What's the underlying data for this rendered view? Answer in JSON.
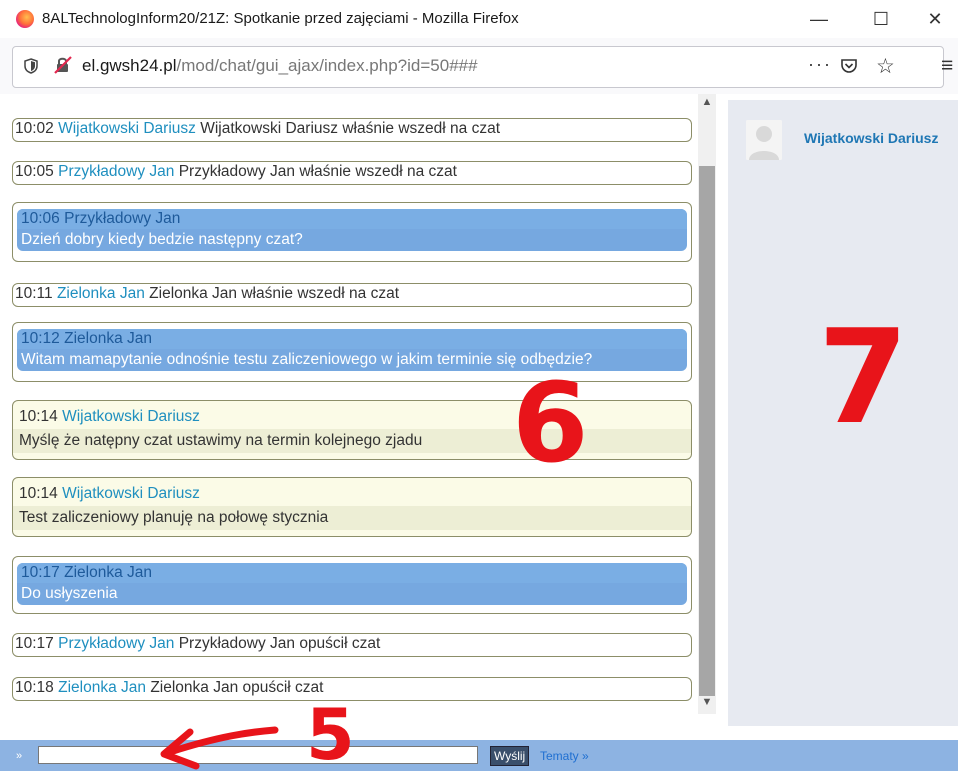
{
  "window": {
    "title": "8ALTechnologInform20/21Z: Spotkanie przed zajęciami - Mozilla Firefox",
    "minimize": "—",
    "maximize": "☐",
    "close": "✕"
  },
  "address_bar": {
    "domain": "el.gwsh24.pl",
    "path": "/mod/chat/gui_ajax/index.php?id=50###",
    "page_actions": "···",
    "bookmark": "☆",
    "menu": "≡"
  },
  "messages": [
    {
      "style": "system",
      "time": "10:02",
      "user": "Wijatkowski Dariusz",
      "text": "Wijatkowski Dariusz właśnie wszedł na czat"
    },
    {
      "style": "system",
      "time": "10:05",
      "user": "Przykładowy Jan",
      "text": "Przykładowy Jan właśnie wszedł na czat"
    },
    {
      "style": "blue",
      "time": "10:06",
      "user": "Przykładowy Jan",
      "text": "Dzień dobry kiedy bedzie następny czat?"
    },
    {
      "style": "system",
      "time": "10:11",
      "user": "Zielonka Jan",
      "text": "Zielonka Jan właśnie wszedł na czat"
    },
    {
      "style": "blue",
      "time": "10:12",
      "user": "Zielonka Jan",
      "text": "Witam mamapytanie odnośnie testu zaliczeniowego w jakim terminie się odbędzie?"
    },
    {
      "style": "yellow",
      "time": "10:14",
      "user": "Wijatkowski Dariusz",
      "text": "Myślę że natępny czat ustawimy na termin kolejnego zjadu"
    },
    {
      "style": "yellow",
      "time": "10:14",
      "user": "Wijatkowski Dariusz",
      "text": "Test zaliczeniowy planuję na połowę stycznia"
    },
    {
      "style": "blue",
      "time": "10:17",
      "user": "Zielonka Jan",
      "text": "Do usłyszenia"
    },
    {
      "style": "system",
      "time": "10:17",
      "user": "Przykładowy Jan",
      "text": "Przykładowy Jan opuścił czat"
    },
    {
      "style": "system",
      "time": "10:18",
      "user": "Zielonka Jan",
      "text": "Zielonka Jan opuścił czat"
    }
  ],
  "users_panel": {
    "users": [
      "Wijatkowski Dariusz"
    ]
  },
  "input_bar": {
    "prompt": "»",
    "send_label": "Wyślij",
    "topics_link": "Tematy »"
  },
  "annotations": {
    "n5": "5",
    "n6": "6",
    "n7": "7",
    "color": "#e8141a"
  },
  "colors": {
    "link": "#1f8fbf",
    "blue_bubble": "#76a8e0",
    "yellow_bubble": "#fbfbe7",
    "input_bar": "#8db3e2",
    "user_panel": "#e7eaf1"
  }
}
